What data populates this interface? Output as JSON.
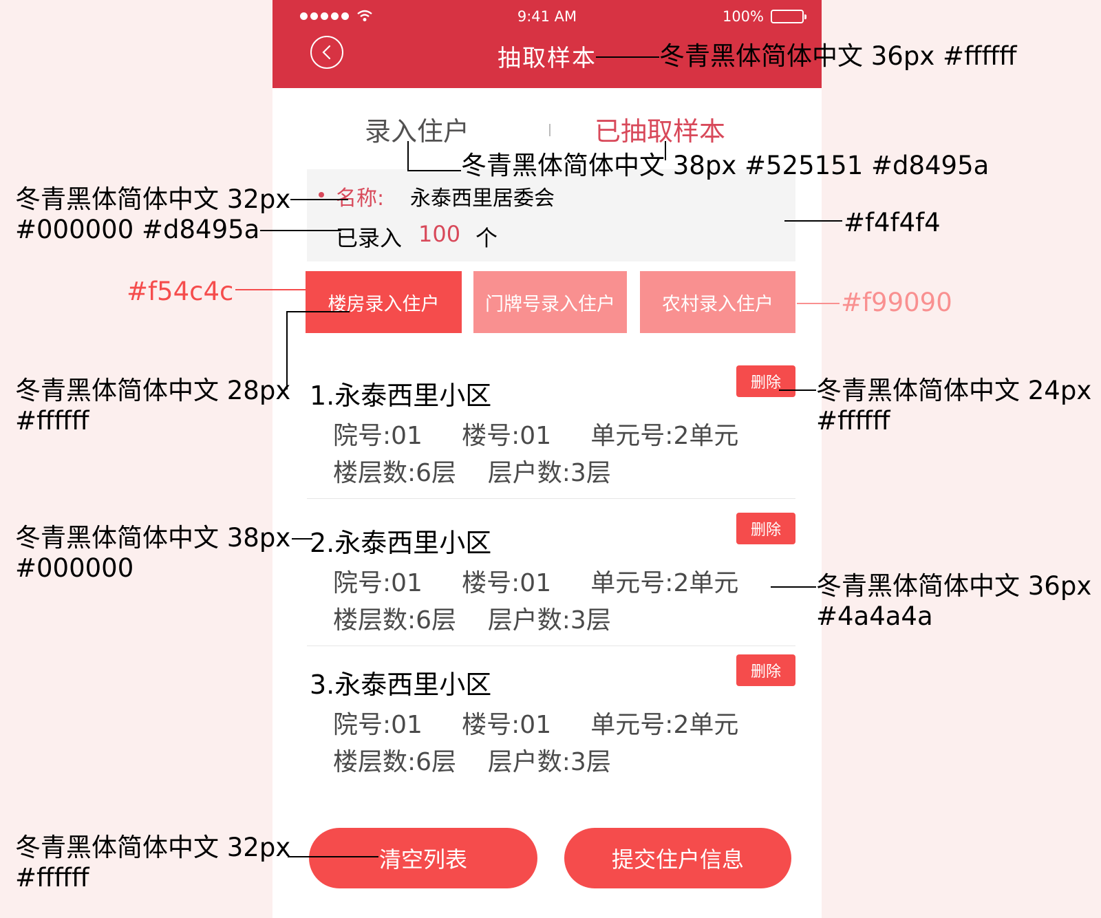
{
  "status_bar": {
    "time": "9:41 AM",
    "battery": "100%"
  },
  "navbar": {
    "title": "抽取样本"
  },
  "tabs": {
    "input": "录入住户",
    "sampled": "已抽取样本"
  },
  "info": {
    "name_label": "名称:",
    "name_value": "永泰西里居委会",
    "count_label": "已录入",
    "count_value": "100",
    "count_unit": "个"
  },
  "entry_buttons": {
    "building": "楼房录入住户",
    "door": "门牌号录入住户",
    "rural": "农村录入住户"
  },
  "items": [
    {
      "title": "1.永泰西里小区",
      "delete": "删除",
      "row1": "院号:01     楼号:01     单元号:2单元",
      "row2": "楼层数:6层    层户数:3层"
    },
    {
      "title": "2.永泰西里小区",
      "delete": "删除",
      "row1": "院号:01     楼号:01     单元号:2单元",
      "row2": "楼层数:6层    层户数:3层"
    },
    {
      "title": "3.永泰西里小区",
      "delete": "删除",
      "row1": "院号:01     楼号:01     单元号:2单元",
      "row2": "楼层数:6层    层户数:3层"
    }
  ],
  "bottom_buttons": {
    "clear": "清空列表",
    "submit": "提交住户信息"
  },
  "annotations": {
    "title_spec": "冬青黑体简体中文 36px #ffffff",
    "tabs_spec": "冬青黑体简体中文 38px #525151 #d8495a",
    "info_spec": "冬青黑体简体中文 32px\n#000000 #d8495a",
    "info_bg": "#f4f4f4",
    "primary_color": "#f54c4c",
    "secondary_color": "#f99090",
    "entry_spec": "冬青黑体简体中文 28px\n#ffffff",
    "delete_spec": "冬青黑体简体中文 24px\n#ffffff",
    "item_title_spec": "冬青黑体简体中文 38px\n#000000",
    "item_detail_spec": "冬青黑体简体中文 36px\n#4a4a4a",
    "bottom_spec": "冬青黑体简体中文 32px\n#ffffff"
  },
  "colors": {
    "navbar": "#d73343",
    "accent": "#d8495a",
    "primary_button": "#f54c4c",
    "secondary_button": "#f99090",
    "info_background": "#f4f4f4",
    "detail_text": "#4a4a4a",
    "page_background": "#fcefee"
  },
  "icons": {
    "back": "chevron-left-in-circle",
    "signal": "signal-dots",
    "wifi": "wifi",
    "battery": "battery-full"
  }
}
